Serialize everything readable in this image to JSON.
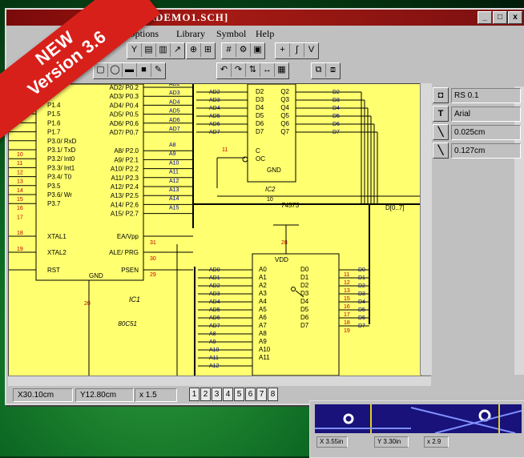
{
  "banner": {
    "line1": "NEW",
    "line2": "Version 3.6"
  },
  "window": {
    "title": "X36\\DEMO1.SCH]",
    "btn_min": "_",
    "btn_max": "□",
    "btn_close": "x"
  },
  "menu": {
    "options": "Options",
    "library": "Library",
    "symbol": "Symbol",
    "help": "Help"
  },
  "schematic": {
    "ic1_left_pins": [
      "P1.4",
      "P1.5",
      "P1.6",
      "P1.7",
      "P3.0/ RxD",
      "P3.1/ TxD",
      "P3.2/ Int0",
      "P3.3/ Int1",
      "P3.4/ T0",
      "P3.5",
      "P3.6/ Wr",
      "P3.7",
      "XTAL1",
      "XTAL2",
      "RST"
    ],
    "ic1_right_pins": [
      "AD2/ P0.2",
      "AD3/ P0.3",
      "AD4/ P0.4",
      "AD5/ P0.5",
      "AD6/ P0.6",
      "AD7/ P0.7",
      "A8/ P2.0",
      "A9/ P2.1",
      "A10/ P2.2",
      "A11/ P2.3",
      "A12/ P2.4",
      "A13/ P2.5",
      "A14/ P2.6",
      "A15/ P2.7",
      "EA/Vpp",
      "ALE/ PRG",
      "PSEN"
    ],
    "ic1_gnd": "GND",
    "ic1_ref": "IC1",
    "ic1_part": "80C51",
    "ic1_bus_labels": [
      "AD2",
      "AD3",
      "AD4",
      "AD5",
      "AD6",
      "AD7",
      "A8",
      "A9",
      "A10",
      "A11",
      "A12",
      "A13",
      "A14",
      "A15"
    ],
    "ic1_left_nums": [
      "10",
      "11",
      "12",
      "13",
      "14",
      "15",
      "16",
      "17",
      "18",
      "19"
    ],
    "ic1_right_nums": [
      "31",
      "30",
      "29"
    ],
    "ic2_in": [
      "D2",
      "D3",
      "D4",
      "D5",
      "D6",
      "D7"
    ],
    "ic2_out": [
      "Q2",
      "Q3",
      "Q4",
      "Q5",
      "Q6",
      "Q7"
    ],
    "ic2_ctrl": [
      "C",
      "OC",
      "GND"
    ],
    "ic2_ref": "IC2",
    "ic2_part": "74573",
    "ic2_pin": "10",
    "ic2_pin_oe": "11",
    "ic2_bus_left": [
      "AD2",
      "AD3",
      "AD4",
      "AD5",
      "AD6",
      "AD7"
    ],
    "ic2_bus_right": [
      "D2",
      "D3",
      "D4",
      "D5",
      "D6",
      "D7"
    ],
    "bus_label": "D[0..7]",
    "ram_vdd": "VDD",
    "ram_pin": "28",
    "ram_a": [
      "A0",
      "A1",
      "A2",
      "A3",
      "A4",
      "A5",
      "A6",
      "A7",
      "A8",
      "A9",
      "A10",
      "A11"
    ],
    "ram_d": [
      "D0",
      "D1",
      "D2",
      "D3",
      "D4",
      "D5",
      "D6",
      "D7"
    ],
    "ram_bus_left": [
      "AD0",
      "AD1",
      "AD2",
      "AD3",
      "AD4",
      "AD5",
      "AD6",
      "AD7",
      "A8",
      "A9",
      "A10",
      "A11",
      "A12"
    ],
    "ram_bus_right": [
      "D0",
      "D1",
      "D2",
      "D3",
      "D4",
      "D5",
      "D6",
      "D7"
    ],
    "ram_right_nums": [
      "11",
      "12",
      "13",
      "15",
      "16",
      "17",
      "18",
      "19"
    ],
    "ic1_pin20": "20"
  },
  "props": {
    "rs": "RS 0.1",
    "font": "Arial",
    "w1": "0.025cm",
    "w2": "0.127cm"
  },
  "status": {
    "x": "X30.10cm",
    "y": "Y12.80cm",
    "zoom": "x 1.5",
    "pages": [
      "1",
      "2",
      "3",
      "4",
      "5",
      "6",
      "7",
      "8"
    ]
  },
  "pcb": {
    "x": "X 3.55in",
    "y": "Y 3.30in",
    "zoom": "x 2.9"
  }
}
